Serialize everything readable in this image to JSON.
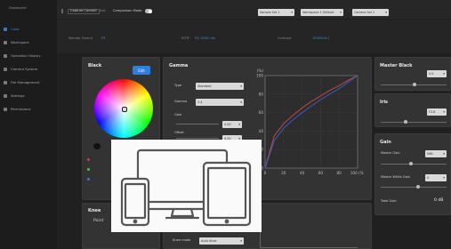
{
  "sidebar": {
    "brand": "Dashboard",
    "items": [
      {
        "label": "Color",
        "active": true
      },
      {
        "label": "Workspace",
        "active": false
      },
      {
        "label": "Operation History",
        "active": false
      },
      {
        "label": "Camera System",
        "active": false
      },
      {
        "label": "File Management",
        "active": false
      },
      {
        "label": "Settings",
        "active": false
      },
      {
        "label": "Permissions",
        "active": false
      }
    ]
  },
  "topbar": {
    "btn1": "Capture Content",
    "btn1_sep": "Exit",
    "toggle_label": "Comparison Mode",
    "dropdowns": [
      "Sample Set 1",
      "Workspace 1 Default",
      "Camera Set 1"
    ]
  },
  "subbar": {
    "field1_label": "Monitor Gamut",
    "field1_value": "P3",
    "field2_label": "EOTF",
    "field2_value": "PQ 1000 nits",
    "field3_label": "Contrast",
    "field3_value": "1000000:1"
  },
  "blank_panel": {
    "title": "Black",
    "button": "Edit"
  },
  "gamma_panel": {
    "title": "Gamma",
    "type_label": "Type",
    "type_value": "Standard",
    "gamma_label": "Gamma",
    "gamma_value": "2.4",
    "gain_label": "Gain",
    "gain_value": "0.00",
    "offset_label": "Offset",
    "offset_value": "0.00"
  },
  "master_black": {
    "title": "Master Black",
    "value": "0.0"
  },
  "iris": {
    "title": "Iris",
    "value": "F2.8"
  },
  "gain": {
    "title": "Gain",
    "row1_label": "Master Gain",
    "row1_value": "0dB",
    "row2_label": "Master White Gain",
    "row2_value": "0",
    "total_label": "Total Gain",
    "total_value": "0 dB"
  },
  "knee": {
    "title": "Knee",
    "sub": "Point",
    "mode_label": "Knee mode",
    "mode_value": "Auto Knee"
  },
  "chart_data": {
    "type": "line",
    "x_ticks": [
      "0",
      "20",
      "40",
      "60",
      "80",
      "100 (%)"
    ],
    "y_ticks": [
      "(%)",
      "100",
      "80",
      "60",
      "40",
      "20",
      "0"
    ],
    "xlim": [
      0,
      100
    ],
    "ylim": [
      0,
      100
    ],
    "series": [
      {
        "color": "#d24a4a",
        "values": [
          [
            0,
            0
          ],
          [
            10,
            35
          ],
          [
            20,
            48
          ],
          [
            30,
            57
          ],
          [
            40,
            65
          ],
          [
            50,
            72
          ],
          [
            60,
            78
          ],
          [
            70,
            84
          ],
          [
            80,
            89
          ],
          [
            90,
            95
          ],
          [
            100,
            100
          ]
        ]
      },
      {
        "color": "#3a5fd0",
        "values": [
          [
            0,
            0
          ],
          [
            10,
            30
          ],
          [
            20,
            43
          ],
          [
            30,
            52
          ],
          [
            40,
            60
          ],
          [
            50,
            67
          ],
          [
            60,
            74
          ],
          [
            70,
            80
          ],
          [
            80,
            86
          ],
          [
            90,
            93
          ],
          [
            100,
            100
          ]
        ]
      }
    ]
  },
  "overlay": {
    "image_label": "Devices illustration"
  }
}
